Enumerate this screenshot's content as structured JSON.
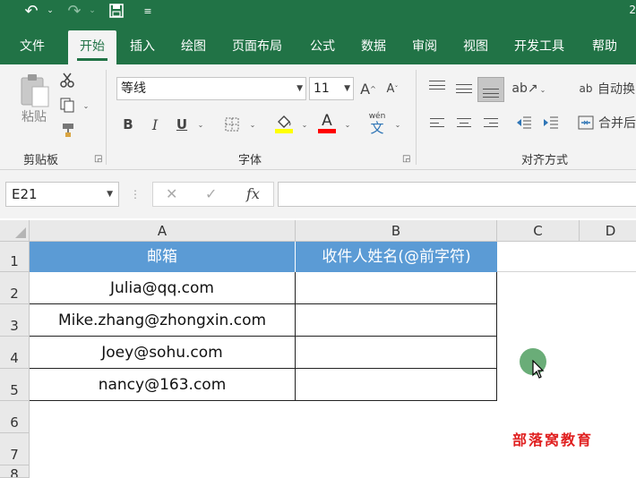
{
  "quick_access": {
    "title_edge": "2"
  },
  "tabs": [
    "文件",
    "开始",
    "插入",
    "绘图",
    "页面布局",
    "公式",
    "数据",
    "审阅",
    "视图",
    "开发工具",
    "帮助"
  ],
  "active_tab": "开始",
  "ribbon": {
    "clipboard": {
      "paste_label": "粘贴",
      "group_label": "剪贴板"
    },
    "font": {
      "font_name": "等线",
      "font_size": "11",
      "group_label": "字体",
      "bold": "B",
      "italic": "I",
      "underline": "U",
      "font_color_glyph": "A",
      "wen_top": "wén",
      "wen_bottom": "文",
      "grow": "A",
      "shrink": "A",
      "fill_color": "#ffff00",
      "font_color": "#ff0000"
    },
    "alignment": {
      "wrap_text": "自动换",
      "merge_center": "合并后",
      "group_label": "对齐方式",
      "ab_glyph": "ab"
    }
  },
  "formula_bar": {
    "name_box": "E21",
    "fx_label": "fx",
    "formula_value": ""
  },
  "sheet": {
    "columns": [
      "A",
      "B",
      "C",
      "D"
    ],
    "rows": [
      "1",
      "2",
      "3",
      "4",
      "5",
      "6",
      "7",
      "8"
    ],
    "header_row": [
      "邮箱",
      "收件人姓名(@前字符)"
    ],
    "emails": [
      "Julia@qq.com",
      "Mike.zhang@zhongxin.com",
      "Joey@sohu.com",
      "nancy@163.com"
    ],
    "header_fill": "#5b9bd5"
  },
  "watermark": "部落窝教育"
}
